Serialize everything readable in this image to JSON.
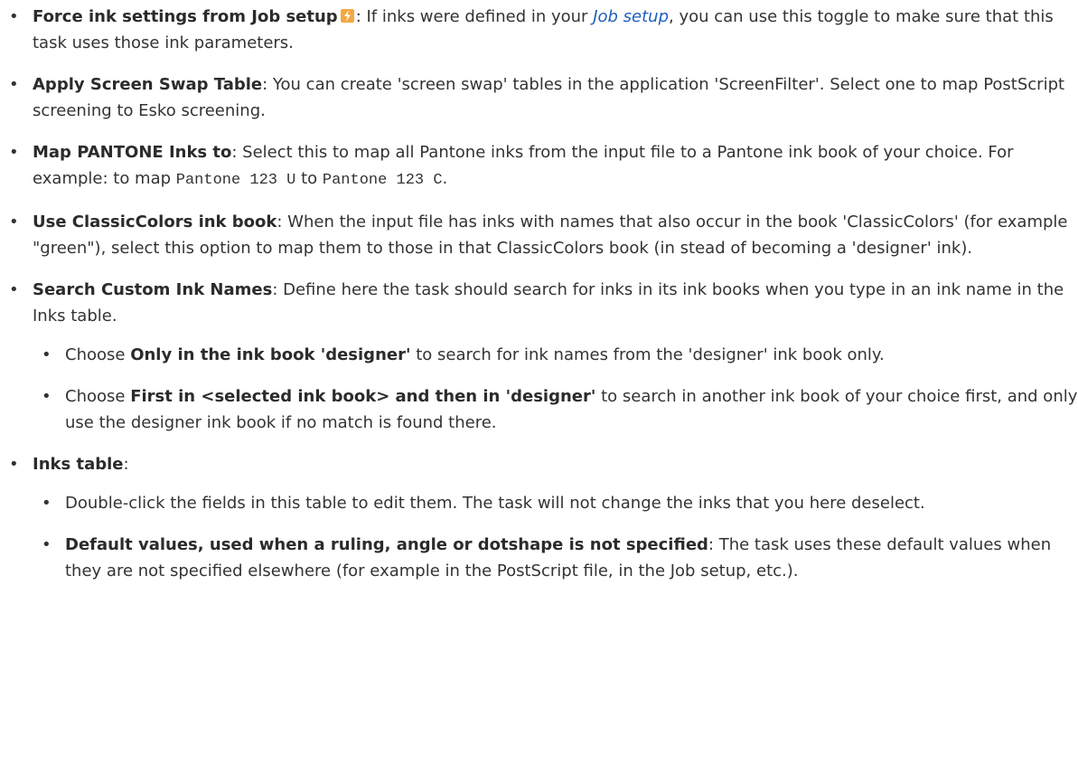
{
  "items": [
    {
      "bold": "Force ink settings from Job setup",
      "text_a": ": If inks were defined in your ",
      "link": "Job setup",
      "text_b": ", you can use this toggle to make sure that this task uses those ink parameters."
    },
    {
      "bold": "Apply Screen Swap Table",
      "text": ": You can create 'screen swap' tables in the application 'ScreenFilter'. Select one to map PostScript screening to Esko screening."
    },
    {
      "bold": "Map PANTONE Inks to",
      "text_a": ": Select this to map all Pantone inks from the input file to a Pantone ink book of your choice. For example: to map ",
      "code_a": "Pantone 123 U",
      "text_b": " to ",
      "code_b": "Pantone 123 C",
      "text_c": "."
    },
    {
      "bold": "Use ClassicColors ink book",
      "text": ": When the input file has inks with names that also occur in the book 'ClassicColors' (for example \"green\"), select this option to map them to those in that ClassicColors book (in stead of becoming a 'designer' ink)."
    },
    {
      "bold": "Search Custom Ink Names",
      "text": ": Define here the task should search for inks in its ink books when you type in an ink name in the Inks table.",
      "sub": [
        {
          "pre": "Choose ",
          "bold": "Only in the ink book 'designer'",
          "post": " to search for ink names from the 'designer' ink book only."
        },
        {
          "pre": "Choose ",
          "bold": "First in <selected ink book> and then in 'designer'",
          "post": " to search in another ink book of your choice first, and only use the designer ink book if no match is found there."
        }
      ]
    },
    {
      "bold": "Inks table",
      "text": ":",
      "sub": [
        {
          "text": "Double-click the fields in this table to edit them. The task will not change the inks that you here deselect."
        },
        {
          "bold": "Default values, used when a ruling, angle or dotshape is not specified",
          "post": ": The task uses these default values when they are not specified elsewhere (for example in the PostScript file, in the Job setup, etc.)."
        }
      ]
    }
  ],
  "bullet": "•",
  "icons": {
    "job_setup_icon": "lightning-bolt-icon",
    "icon_color": "#f4a742",
    "link_color": "#1f5fbf"
  }
}
